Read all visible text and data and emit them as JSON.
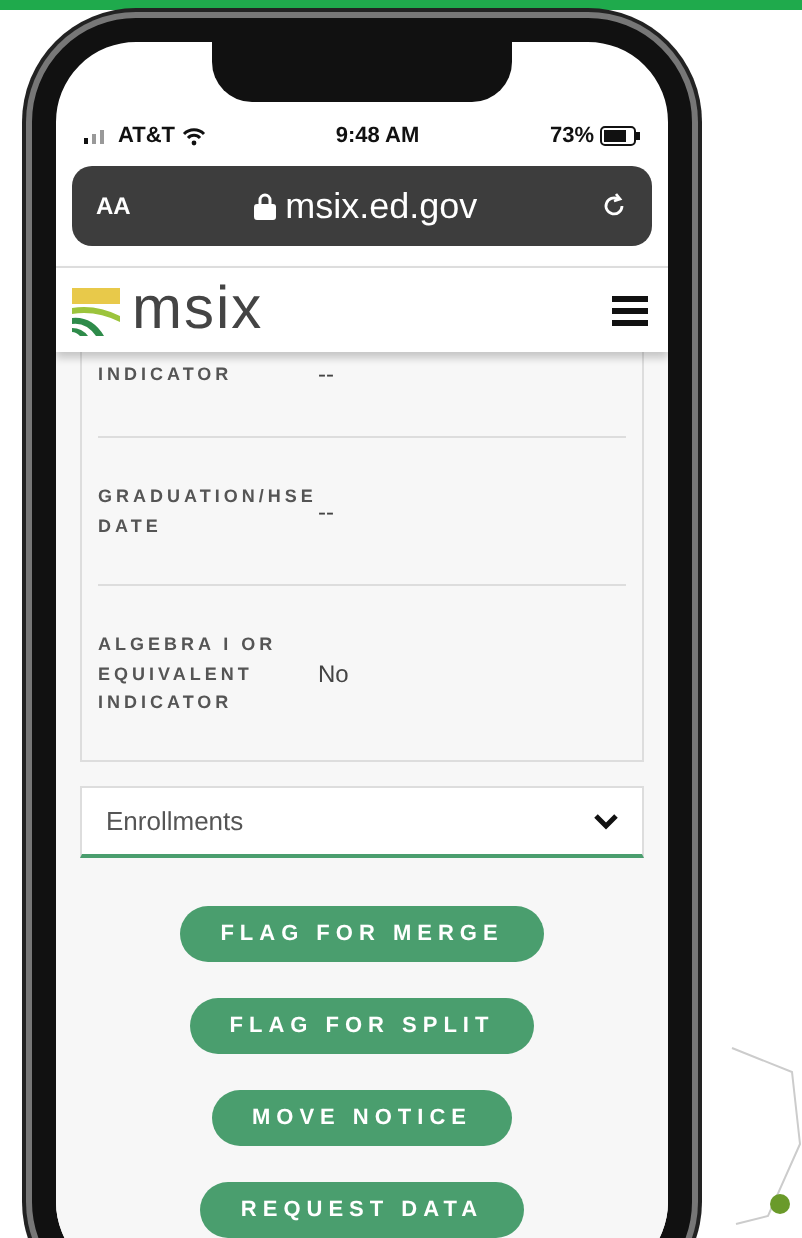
{
  "status_bar": {
    "carrier": "AT&T",
    "time": "9:48 AM",
    "battery": "73%"
  },
  "address_bar": {
    "text_size": "AA",
    "url": "msix.ed.gov"
  },
  "header": {
    "logo_text": "msix"
  },
  "details": [
    {
      "label": "INDICATOR",
      "value": "--"
    },
    {
      "label": "GRADUATION/HSE DATE",
      "value": "--"
    },
    {
      "label": "ALGEBRA I OR EQUIVALENT INDICATOR",
      "value": "No"
    }
  ],
  "dropdown": {
    "label": "Enrollments",
    "expanded": false
  },
  "buttons": [
    "FLAG FOR MERGE",
    "FLAG FOR SPLIT",
    "MOVE NOTICE",
    "REQUEST DATA"
  ]
}
